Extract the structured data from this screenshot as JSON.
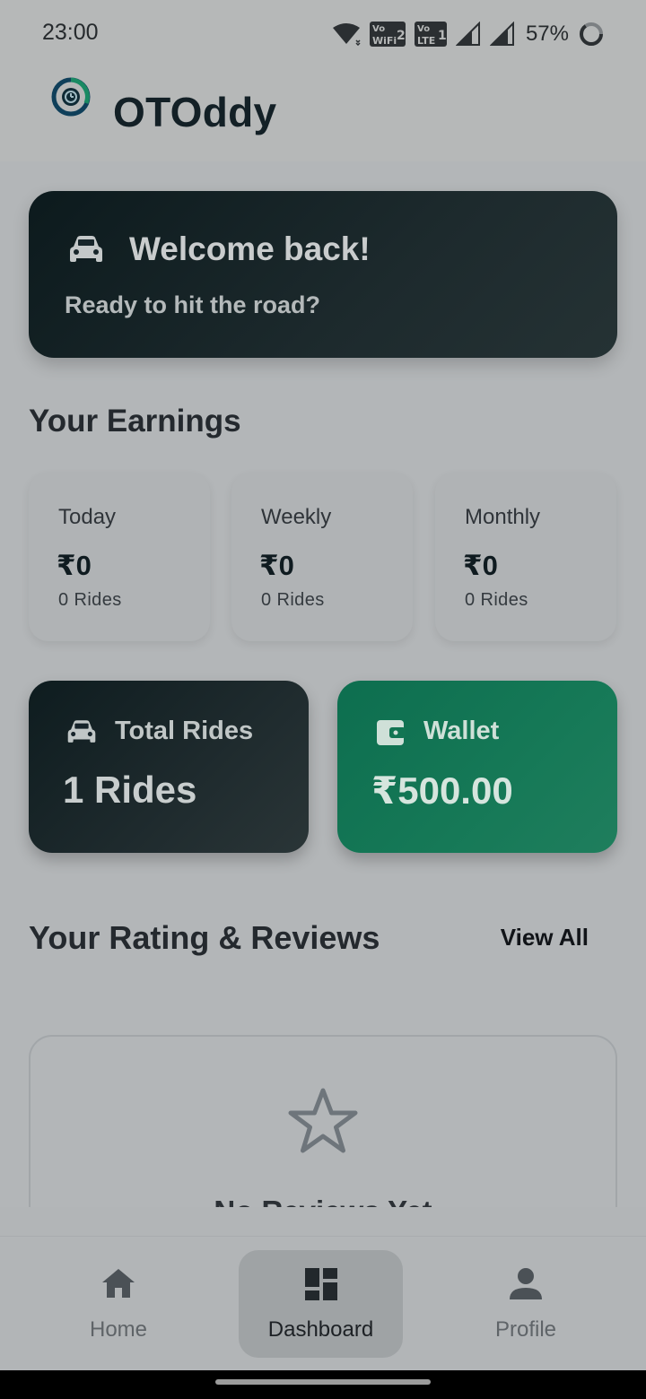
{
  "status_bar": {
    "time": "23:00",
    "icons": [
      "wifi-icon",
      "vowifi-2-icon",
      "volte-1-icon",
      "signal-1-icon",
      "signal-2-icon"
    ],
    "battery": "57%"
  },
  "header": {
    "app_name": "OTOddy",
    "logo": "app-logo-icon"
  },
  "welcome_card": {
    "icon": "car-icon",
    "title": "Welcome back!",
    "subtitle": "Ready to hit the road?"
  },
  "earnings": {
    "section_title": "Your Earnings",
    "cards": [
      {
        "label": "Today",
        "amount": "₹0",
        "rides": "0 Rides"
      },
      {
        "label": "Weekly",
        "amount": "₹0",
        "rides": "0 Rides"
      },
      {
        "label": "Monthly",
        "amount": "₹0",
        "rides": "0 Rides"
      }
    ]
  },
  "stats": {
    "total_rides": {
      "icon": "car-icon",
      "label": "Total Rides",
      "value": "1 Rides"
    },
    "wallet": {
      "icon": "wallet-icon",
      "label": "Wallet",
      "value": "₹500.00"
    }
  },
  "reviews": {
    "section_title": "Your Rating & Reviews",
    "view_all": "View All",
    "empty_icon": "star-outline-icon",
    "empty_text": "No Reviews Yet"
  },
  "bottom_nav": {
    "active": "Dashboard",
    "items": [
      {
        "label": "Home",
        "icon": "home-icon"
      },
      {
        "label": "Dashboard",
        "icon": "dashboard-icon"
      },
      {
        "label": "Profile",
        "icon": "person-icon"
      }
    ]
  },
  "colors": {
    "dark_card": "#13211f",
    "wallet_green": "#117452",
    "overlay_bg": "#b3b6b8"
  }
}
